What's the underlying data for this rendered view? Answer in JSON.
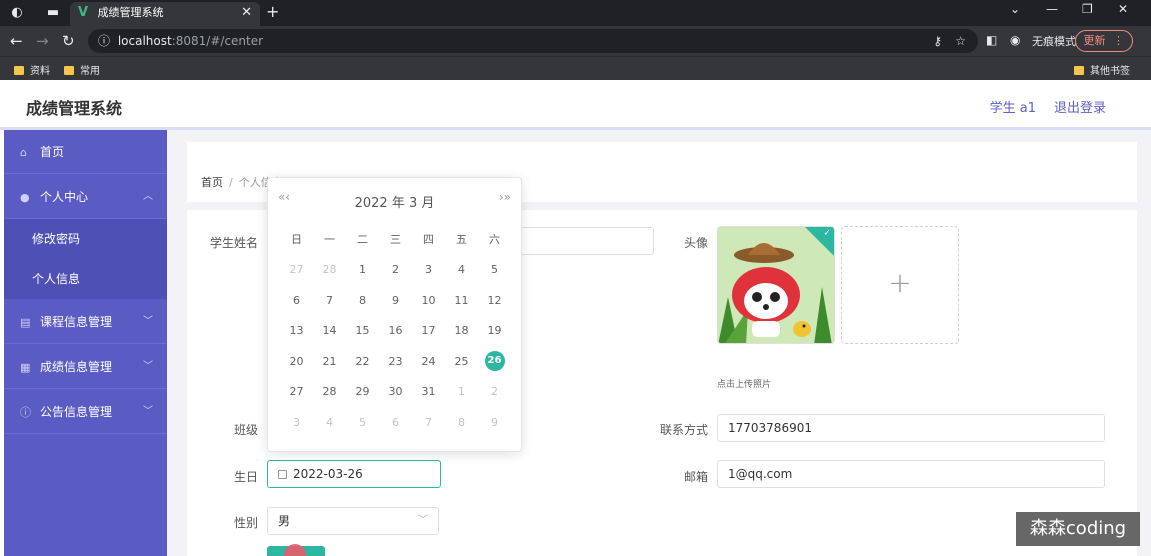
{
  "browser": {
    "tab_title": "成绩管理系统",
    "tab_logo": "V",
    "new_tab": "+",
    "url_host": "localhost",
    "url_path": ":8081/#/center",
    "incognito_label": "无痕模式",
    "update_label": "更新",
    "bookmarks": [
      "资料",
      "常用"
    ],
    "other_bookmarks": "其他书签"
  },
  "header": {
    "title": "成绩管理系统",
    "user": "学生 a1",
    "logout": "退出登录"
  },
  "sidebar": {
    "home": "首页",
    "personal_center": "个人中心",
    "sub_items": [
      "修改密码",
      "个人信息"
    ],
    "groups": [
      "课程信息管理",
      "成绩信息管理",
      "公告信息管理"
    ]
  },
  "breadcrumb": {
    "home": "首页",
    "separator": "/",
    "current": "个人信息"
  },
  "form": {
    "name_label": "学生姓名",
    "avatar_label": "头像",
    "upload_tip": "点击上传照片",
    "upload_plus": "+",
    "class_label": "班级",
    "phone_label": "联系方式",
    "phone_value": "17703786901",
    "birthday_label": "生日",
    "birthday_value": "2022-03-26",
    "email_label": "邮箱",
    "email_value": "1@qq.com",
    "gender_label": "性别",
    "gender_value": "男"
  },
  "datepicker": {
    "title": "2022 年  3 月",
    "prev_nav": "«‹",
    "next_nav": "›»",
    "weekdays": [
      "日",
      "一",
      "二",
      "三",
      "四",
      "五",
      "六"
    ],
    "weeks": [
      [
        {
          "d": "27",
          "t": "prev"
        },
        {
          "d": "28",
          "t": "prev"
        },
        {
          "d": "1"
        },
        {
          "d": "2"
        },
        {
          "d": "3"
        },
        {
          "d": "4"
        },
        {
          "d": "5"
        }
      ],
      [
        {
          "d": "6"
        },
        {
          "d": "7"
        },
        {
          "d": "8"
        },
        {
          "d": "9"
        },
        {
          "d": "10"
        },
        {
          "d": "11"
        },
        {
          "d": "12"
        }
      ],
      [
        {
          "d": "13"
        },
        {
          "d": "14"
        },
        {
          "d": "15"
        },
        {
          "d": "16"
        },
        {
          "d": "17"
        },
        {
          "d": "18"
        },
        {
          "d": "19"
        }
      ],
      [
        {
          "d": "20"
        },
        {
          "d": "21"
        },
        {
          "d": "22"
        },
        {
          "d": "23"
        },
        {
          "d": "24"
        },
        {
          "d": "25"
        },
        {
          "d": "26",
          "t": "today"
        }
      ],
      [
        {
          "d": "27"
        },
        {
          "d": "28"
        },
        {
          "d": "29"
        },
        {
          "d": "30"
        },
        {
          "d": "31"
        },
        {
          "d": "1",
          "t": "next"
        },
        {
          "d": "2",
          "t": "next"
        }
      ],
      [
        {
          "d": "3",
          "t": "next"
        },
        {
          "d": "4",
          "t": "next"
        },
        {
          "d": "5",
          "t": "next"
        },
        {
          "d": "6",
          "t": "next"
        },
        {
          "d": "7",
          "t": "next"
        },
        {
          "d": "8",
          "t": "next"
        },
        {
          "d": "9",
          "t": "next"
        }
      ]
    ]
  },
  "watermark": "森森coding",
  "colors": {
    "sidebar": "#5a5cc4",
    "accent": "#2bb7a0",
    "header_link": "#5b5fc7"
  }
}
